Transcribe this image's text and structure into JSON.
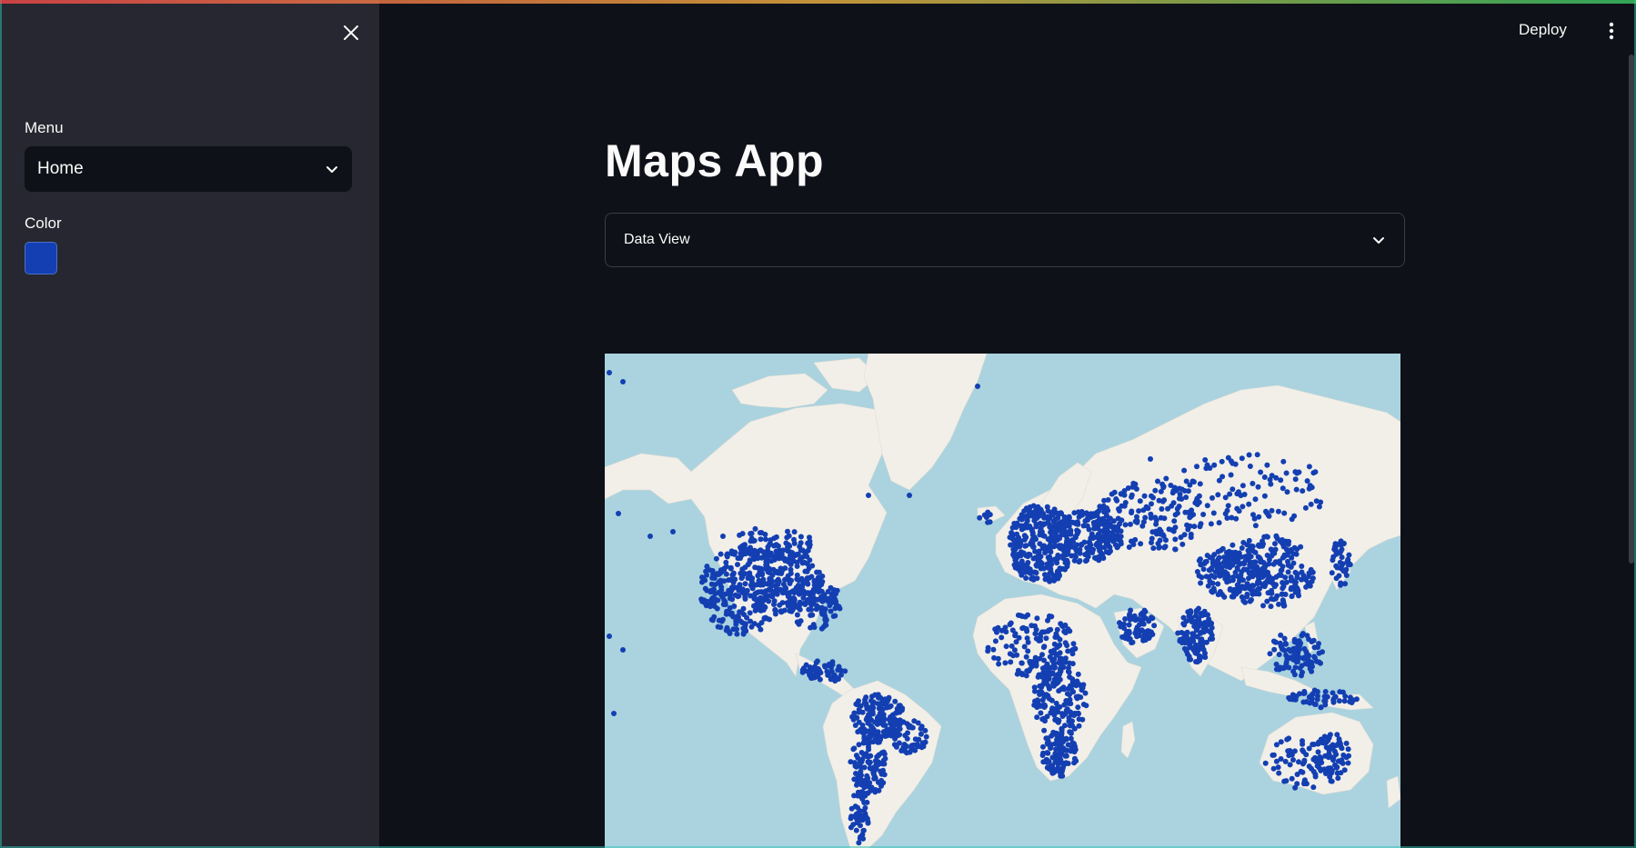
{
  "sidebar": {
    "menu_label": "Menu",
    "menu_value": "Home",
    "color_label": "Color",
    "color_value": "#133fb2"
  },
  "header": {
    "deploy_label": "Deploy"
  },
  "main": {
    "title": "Maps App",
    "expander_label": "Data View"
  },
  "map": {
    "land_color": "#f2efe9",
    "water_color": "#aad3df",
    "point_color": "#133fb2"
  },
  "icons": {
    "close": "close-icon",
    "menu_chevron": "chevron-down-icon",
    "expander_chevron": "chevron-down-icon",
    "more": "kebab-menu-icon"
  }
}
